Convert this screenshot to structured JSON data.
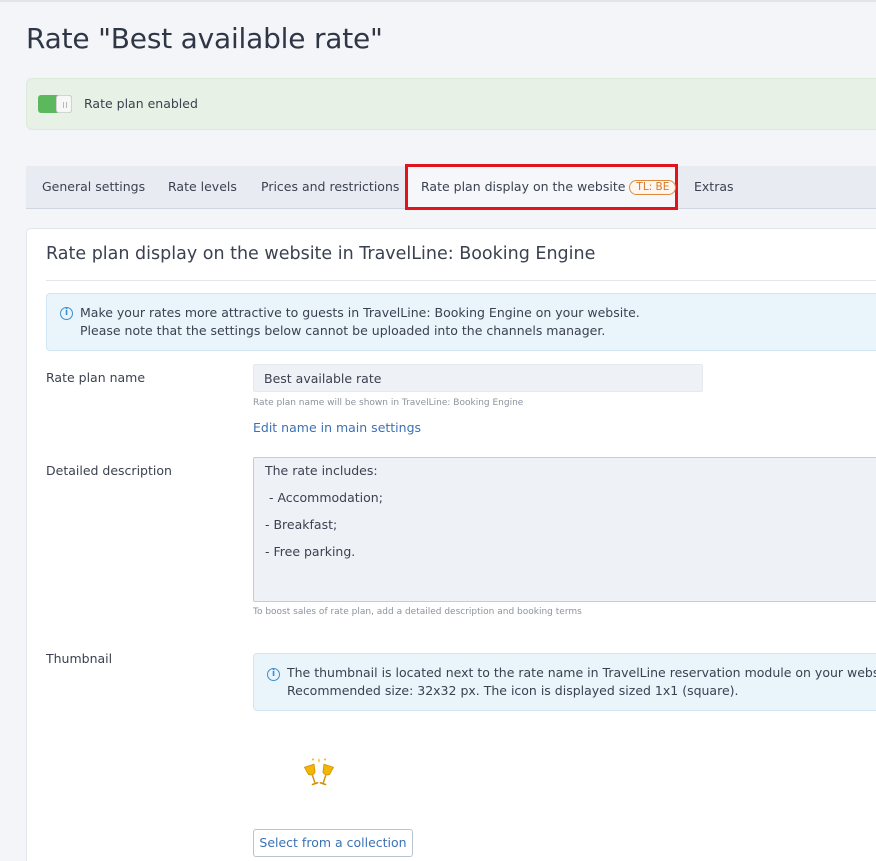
{
  "page": {
    "title": "Rate \"Best available rate\""
  },
  "status": {
    "enabled": true,
    "label": "Rate plan enabled"
  },
  "tabs": [
    {
      "label": "General settings"
    },
    {
      "label": "Rate levels"
    },
    {
      "label": "Prices and restrictions"
    },
    {
      "label": "Rate plan display on the website",
      "badge": "TL: BE",
      "active": true
    },
    {
      "label": "Extras"
    }
  ],
  "panel": {
    "title": "Rate plan display on the website in TravelLine: Booking Engine",
    "info": {
      "line1": "Make your rates more attractive to guests in TravelLine: Booking Engine on your website.",
      "line2": "Please note that the settings below cannot be uploaded into the channels manager."
    },
    "rate_plan_name": {
      "label": "Rate plan name",
      "value": "Best available rate",
      "hint": "Rate plan name will be shown in TravelLine: Booking Engine",
      "edit_link": "Edit name in main settings"
    },
    "description": {
      "label": "Detailed description",
      "lines": [
        "The rate includes:",
        " - Accommodation;",
        "- Breakfast;",
        "- Free parking."
      ],
      "hint": "To boost sales of rate plan, add a detailed description and booking terms"
    },
    "thumbnail": {
      "label": "Thumbnail",
      "info_line1": "The thumbnail is located next to the rate name in TravelLine reservation module on your website.",
      "info_line2": "Recommended size: 32x32 px. The icon is displayed sized 1x1 (square).",
      "icon": "champagne-glasses-icon",
      "select_button": "Select from a collection"
    }
  },
  "colors": {
    "accent_link": "#3b72b4",
    "highlight_border": "#e3131b",
    "toggle_on": "#5cb85c",
    "badge": "#d67a2a"
  }
}
